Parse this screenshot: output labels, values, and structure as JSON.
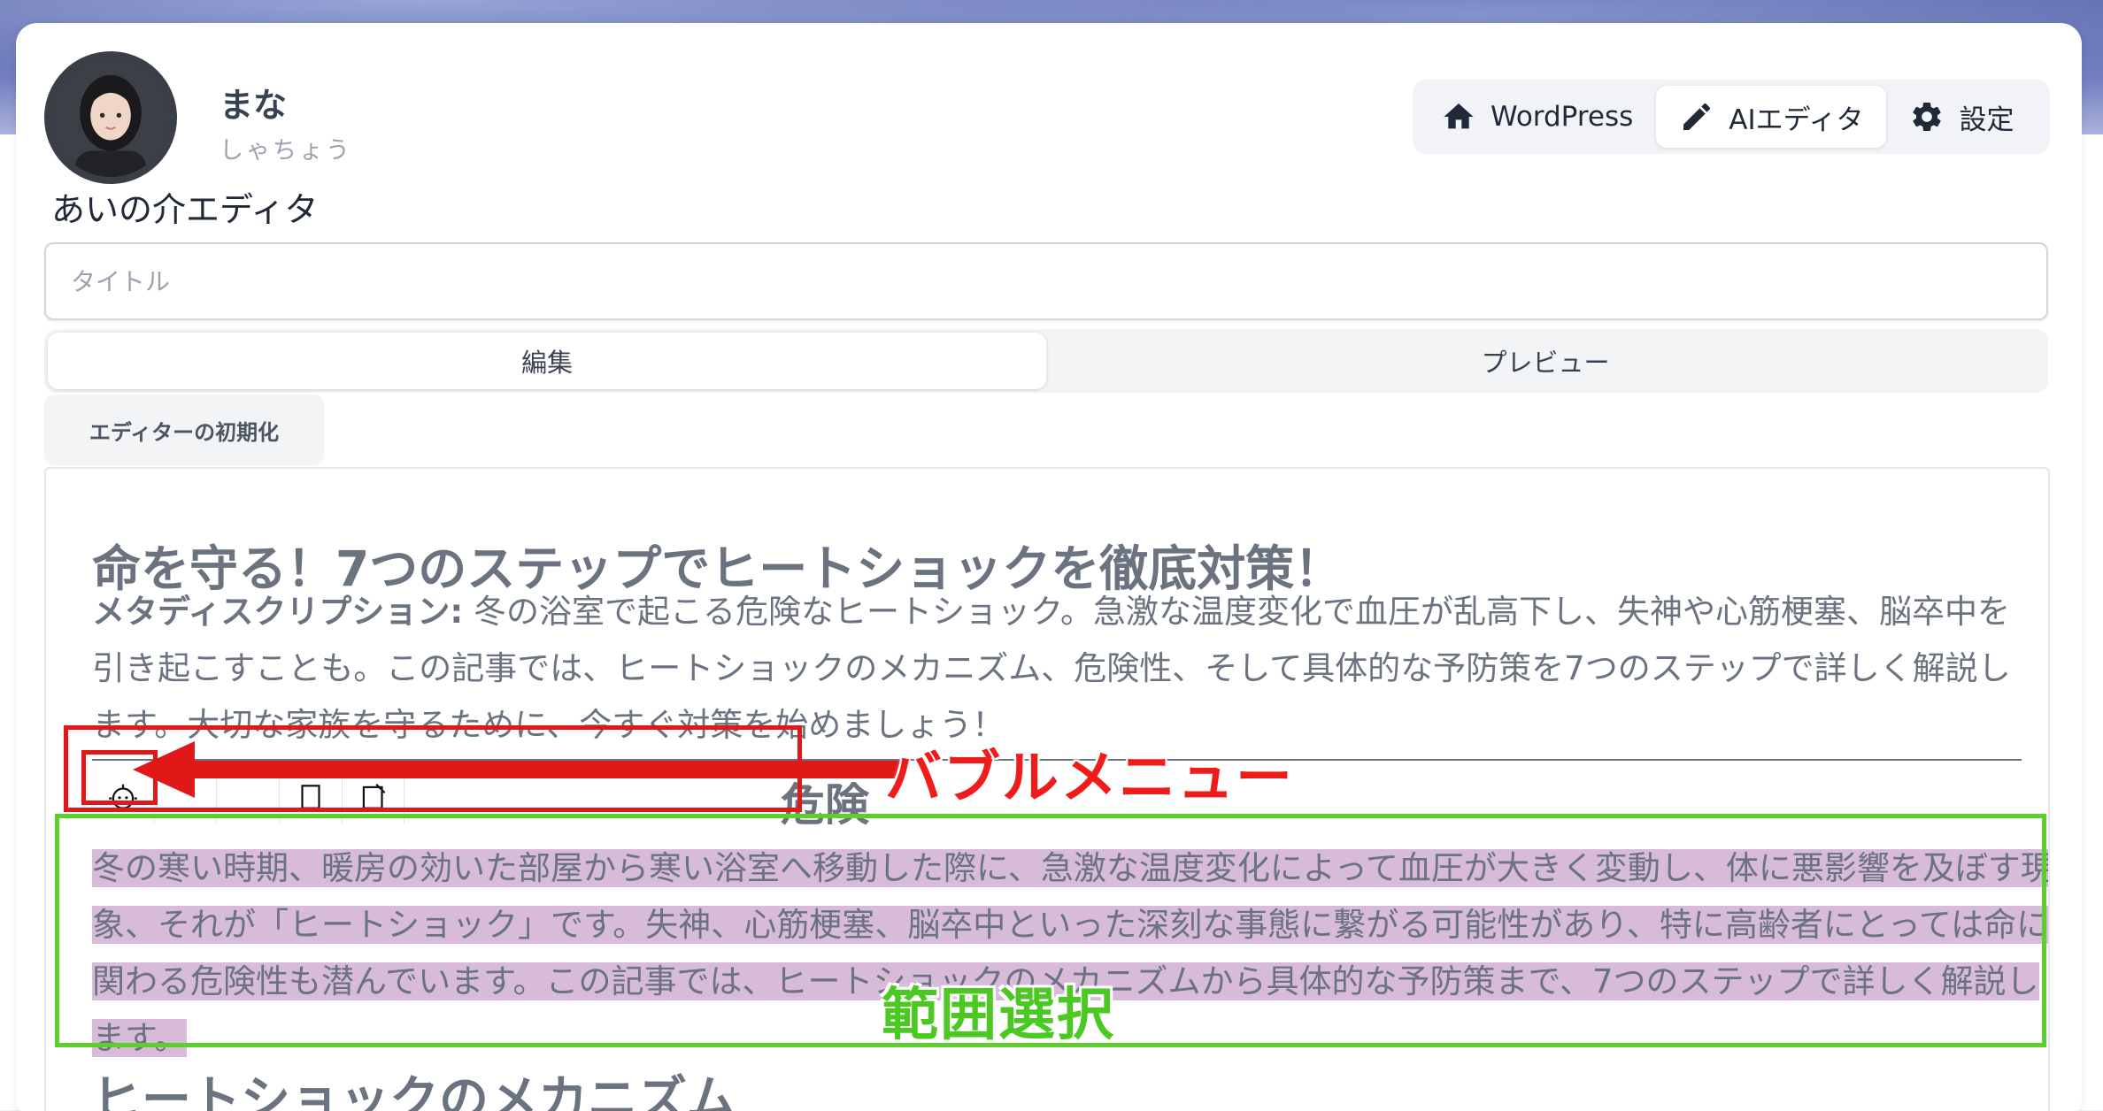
{
  "user": {
    "name": "まな",
    "role": "しゃちょう"
  },
  "app_title": "あいの介エディタ",
  "nav": {
    "items": [
      {
        "label": "WordPress",
        "icon": "home-icon",
        "active": false
      },
      {
        "label": "AIエディタ",
        "icon": "pencil-icon",
        "active": true
      },
      {
        "label": "設定",
        "icon": "gear-icon",
        "active": false
      }
    ]
  },
  "title_input": {
    "value": "",
    "placeholder": "タイトル"
  },
  "tabs": [
    {
      "label": "編集",
      "active": true
    },
    {
      "label": "プレビュー",
      "active": false
    }
  ],
  "reset_button": {
    "label": "エディターの初期化"
  },
  "article": {
    "title": "命を守る！7つのステップでヒートショックを徹底対策！",
    "meta_label": "メタディスクリプション:",
    "meta_text": " 冬の浴室で起こる危険なヒートショック。急激な温度変化で血圧が乱高下し、失神や心筋梗塞、脳卒中を引き起こすことも。この記事では、ヒートショックのメカニズム、危険性、そして具体的な予防策を7つのステップで詳しく解説します。大切な家族を守るために、今すぐ対策を始めましょう！",
    "h2_partial": "危険",
    "paragraph": "冬の寒い時期、暖房の効いた部屋から寒い浴室へ移動した際に、急激な温度変化によって血圧が大きく変動し、体に悪影響を及ぼす現象、それが「ヒートショック」です。失神、心筋梗塞、脳卒中といった深刻な事態に繋がる可能性があり、特に高齢者にとっては命に関わる危険性も潜んでいます。この記事では、ヒートショックのメカニズムから具体的な予防策まで、7つのステップで詳しく解説します。",
    "h2_mechanism": "ヒートショックのメカニズム"
  },
  "bubble_menu": {
    "icons": [
      "ai-face-icon",
      "blank",
      "blank",
      "copy-icon",
      "edit-icon",
      "blank"
    ]
  },
  "annotations": {
    "bubble_label": "バブルメニュー",
    "selection_label": "範囲選択"
  },
  "colors": {
    "accent_red": "#e01818",
    "accent_green": "#5ccf2a",
    "selection": "#d7bbd8"
  }
}
